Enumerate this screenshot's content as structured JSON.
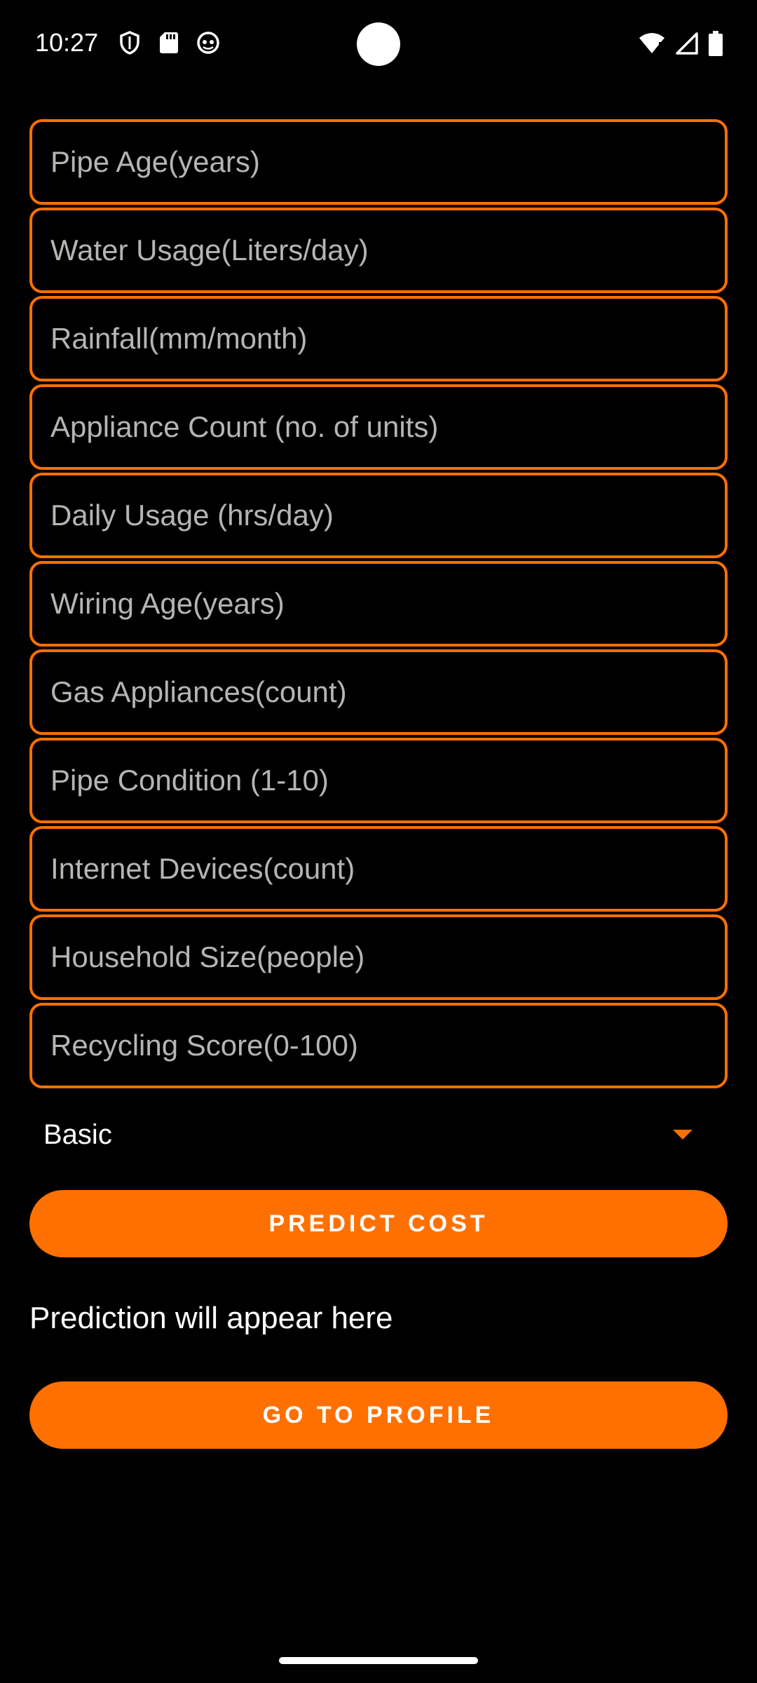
{
  "status_bar": {
    "time": "10:27"
  },
  "fields": [
    {
      "placeholder": "Pipe Age(years)",
      "value": ""
    },
    {
      "placeholder": "Water Usage(Liters/day)",
      "value": ""
    },
    {
      "placeholder": "Rainfall(mm/month)",
      "value": ""
    },
    {
      "placeholder": "Appliance Count (no. of units)",
      "value": ""
    },
    {
      "placeholder": "Daily Usage (hrs/day)",
      "value": ""
    },
    {
      "placeholder": "Wiring Age(years)",
      "value": ""
    },
    {
      "placeholder": "Gas Appliances(count)",
      "value": ""
    },
    {
      "placeholder": "Pipe Condition (1-10)",
      "value": ""
    },
    {
      "placeholder": "Internet Devices(count)",
      "value": ""
    },
    {
      "placeholder": "Household Size(people)",
      "value": ""
    },
    {
      "placeholder": "Recycling Score(0-100)",
      "value": ""
    }
  ],
  "dropdown": {
    "selected": "Basic"
  },
  "buttons": {
    "predict_label": "PREDICT COST",
    "profile_label": "GO TO PROFILE"
  },
  "prediction": {
    "text": "Prediction will appear here"
  },
  "colors": {
    "accent": "#ff7000",
    "background": "#000000",
    "placeholder": "#b5b5b5",
    "text": "#ffffff"
  }
}
